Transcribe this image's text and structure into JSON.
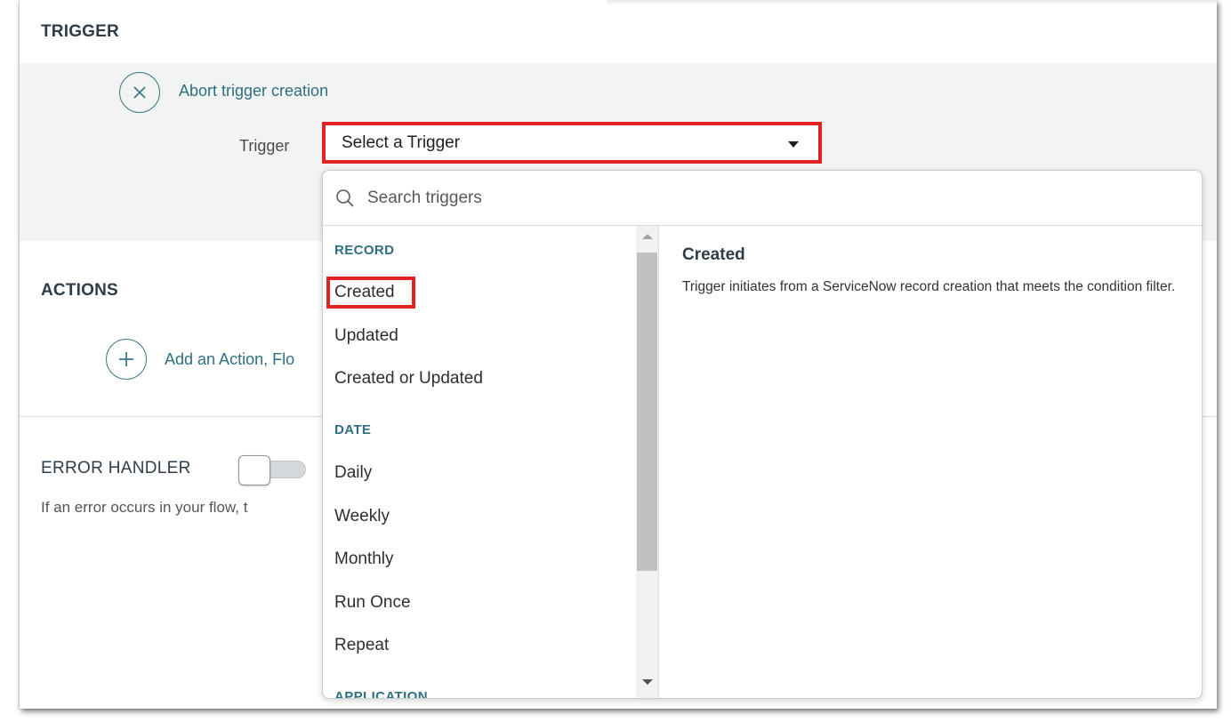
{
  "trigger_section": {
    "title": "TRIGGER",
    "abort_link": "Abort trigger creation",
    "trigger_label": "Trigger",
    "select_value": "Select a Trigger"
  },
  "actions_section": {
    "title": "ACTIONS",
    "add_link": "Add an Action, Flo"
  },
  "error_handler": {
    "title": "ERROR HANDLER",
    "enabled": false,
    "description": "If an error occurs in your flow, t"
  },
  "dropdown": {
    "search_placeholder": "Search triggers",
    "groups": [
      {
        "header": "RECORD",
        "items": [
          "Created",
          "Updated",
          "Created or Updated"
        ]
      },
      {
        "header": "DATE",
        "items": [
          "Daily",
          "Weekly",
          "Monthly",
          "Run Once",
          "Repeat"
        ]
      },
      {
        "header": "APPLICATION",
        "items": []
      }
    ],
    "highlighted_item": "Created",
    "detail": {
      "title": "Created",
      "description": "Trigger initiates from a ServiceNow record creation that meets the condition filter."
    }
  },
  "colors": {
    "accent": "#2f6f80",
    "highlight_red": "#e02222",
    "band_background": "#f1f4f3"
  }
}
